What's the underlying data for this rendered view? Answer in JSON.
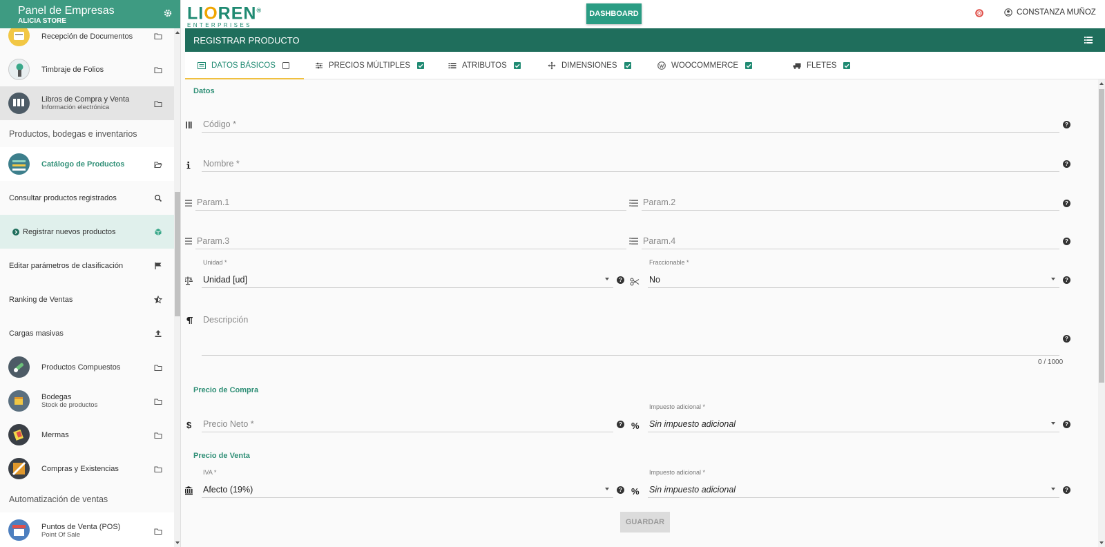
{
  "sidebar": {
    "title": "Panel de Empresas",
    "subtitle": "ALICIA STORE",
    "items": [
      {
        "label": "Recepción de Documentos",
        "sub": ""
      },
      {
        "label": "Timbraje de Folios",
        "sub": ""
      },
      {
        "label": "Libros de Compra y Venta",
        "sub": "Información electrónica"
      },
      {
        "label": "Productos, bodegas e inventarios"
      },
      {
        "label": "Catálogo de Productos"
      },
      {
        "label": "Consultar productos registrados"
      },
      {
        "label": "Registrar nuevos productos"
      },
      {
        "label": "Editar parámetros de clasificación"
      },
      {
        "label": "Ranking de Ventas"
      },
      {
        "label": "Cargas masivas"
      },
      {
        "label": "Productos Compuestos",
        "sub": ""
      },
      {
        "label": "Bodegas",
        "sub": "Stock de productos"
      },
      {
        "label": "Mermas",
        "sub": ""
      },
      {
        "label": "Compras y Existencias",
        "sub": ""
      },
      {
        "label": "Automatización de ventas"
      },
      {
        "label": "Puntos de Venta (POS)",
        "sub": "Point Of Sale"
      }
    ]
  },
  "topbar": {
    "logo_main_a": "LI",
    "logo_main_o": "O",
    "logo_main_b": "REN",
    "logo_reg": "®",
    "logo_sub": "ENTERPRISES",
    "dashboard_label": "DASHBOARD",
    "user_name": "CONSTANZA MUÑOZ"
  },
  "page": {
    "title": "REGISTRAR PRODUCTO"
  },
  "tabs": [
    {
      "label": "DATOS BÁSICOS",
      "checked": false
    },
    {
      "label": "PRECIOS MÚLTIPLES",
      "checked": true
    },
    {
      "label": "ATRIBUTOS",
      "checked": true
    },
    {
      "label": "DIMENSIONES",
      "checked": true
    },
    {
      "label": "WOOCOMMERCE",
      "checked": true
    },
    {
      "label": "FLETES",
      "checked": true
    }
  ],
  "form": {
    "section_datos": "Datos",
    "codigo_ph": "Código *",
    "nombre_ph": "Nombre *",
    "param1_ph": "Param.1",
    "param2_ph": "Param.2",
    "param3_ph": "Param.3",
    "param4_ph": "Param.4",
    "unidad_label": "Unidad *",
    "unidad_value": "Unidad [ud]",
    "fraccionable_label": "Fraccionable *",
    "fraccionable_value": "No",
    "descripcion_ph": "Descripción",
    "descripcion_counter": "0 / 1000",
    "section_compra": "Precio de Compra",
    "precio_neto_ph": "Precio Neto *",
    "imp_compra_label": "Impuesto adicional *",
    "imp_compra_value": "Sin impuesto adicional",
    "section_venta": "Precio de Venta",
    "iva_label": "IVA *",
    "iva_value": "Afecto (19%)",
    "imp_venta_label": "Impuesto adicional *",
    "imp_venta_value": "Sin impuesto adicional",
    "save_label": "GUARDAR"
  },
  "colors": {
    "brand": "#3e9b82",
    "header": "#1f6e5c",
    "accent": "#1f8a72",
    "logo_orange": "#f0a500",
    "tab_underline": "#f0c040"
  }
}
